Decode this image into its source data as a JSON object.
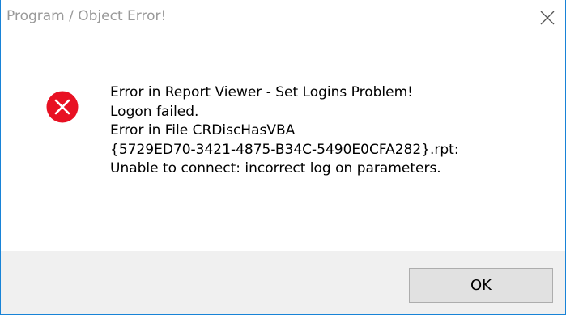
{
  "dialog": {
    "title": "Program / Object Error!",
    "close_icon": "close-icon",
    "icon": "error-icon",
    "message_lines": [
      "Error in Report Viewer - Set Logins Problem!",
      "Logon failed.",
      "Error in File CRDiscHasVBA",
      "{5729ED70-3421-4875-B34C-5490E0CFA282}.rpt:",
      "Unable to connect: incorrect log on parameters."
    ],
    "ok_label": "OK"
  },
  "colors": {
    "border": "#1883d7",
    "error_red": "#e81123",
    "footer_bg": "#f0f0f0",
    "title_text": "#999999"
  }
}
